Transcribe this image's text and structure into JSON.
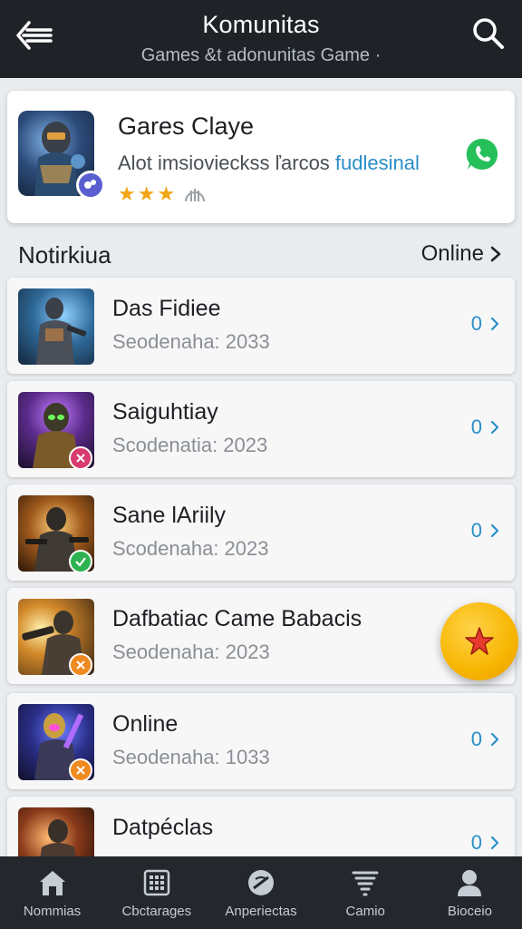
{
  "header": {
    "title": "Komunitas",
    "subtitle": "Games &t adonunitas Game ·"
  },
  "featured": {
    "name": "Gares Claye",
    "desc_main": "Alot imsiovieckss ľarcos ",
    "desc_accent": "fudlesinal",
    "rating": 3
  },
  "section": {
    "label": "Notirkiua",
    "online_label": "Online"
  },
  "list": [
    {
      "name": "Das Fidiee",
      "meta": "Seodenaha: 2033",
      "count": "0"
    },
    {
      "name": "Saiguhtiay",
      "meta": "Scodenatia: 2023",
      "count": "0"
    },
    {
      "name": "Sane lAriily",
      "meta": "Scodenaha: 2023",
      "count": "0"
    },
    {
      "name": "Dafbatiac Came Babacis",
      "meta": "Seodenaha: 2023",
      "count": ""
    },
    {
      "name": "Online",
      "meta": "Seodenaha: 1033",
      "count": "0"
    },
    {
      "name": "Datpéclas",
      "meta": "",
      "count": "0"
    }
  ],
  "bottom_nav": [
    {
      "label": "Nommias",
      "icon": "home-icon"
    },
    {
      "label": "Cbctarages",
      "icon": "grid-icon"
    },
    {
      "label": "Anperiectas",
      "icon": "compass-icon"
    },
    {
      "label": "Camio",
      "icon": "tornado-icon"
    },
    {
      "label": "Bioceio",
      "icon": "user-icon"
    }
  ],
  "colors": {
    "header_bg": "#1f2328",
    "accent": "#2a8fc8",
    "fab": "#f7b500",
    "nav_bg": "#24282d",
    "whatsapp": "#25c05a"
  }
}
